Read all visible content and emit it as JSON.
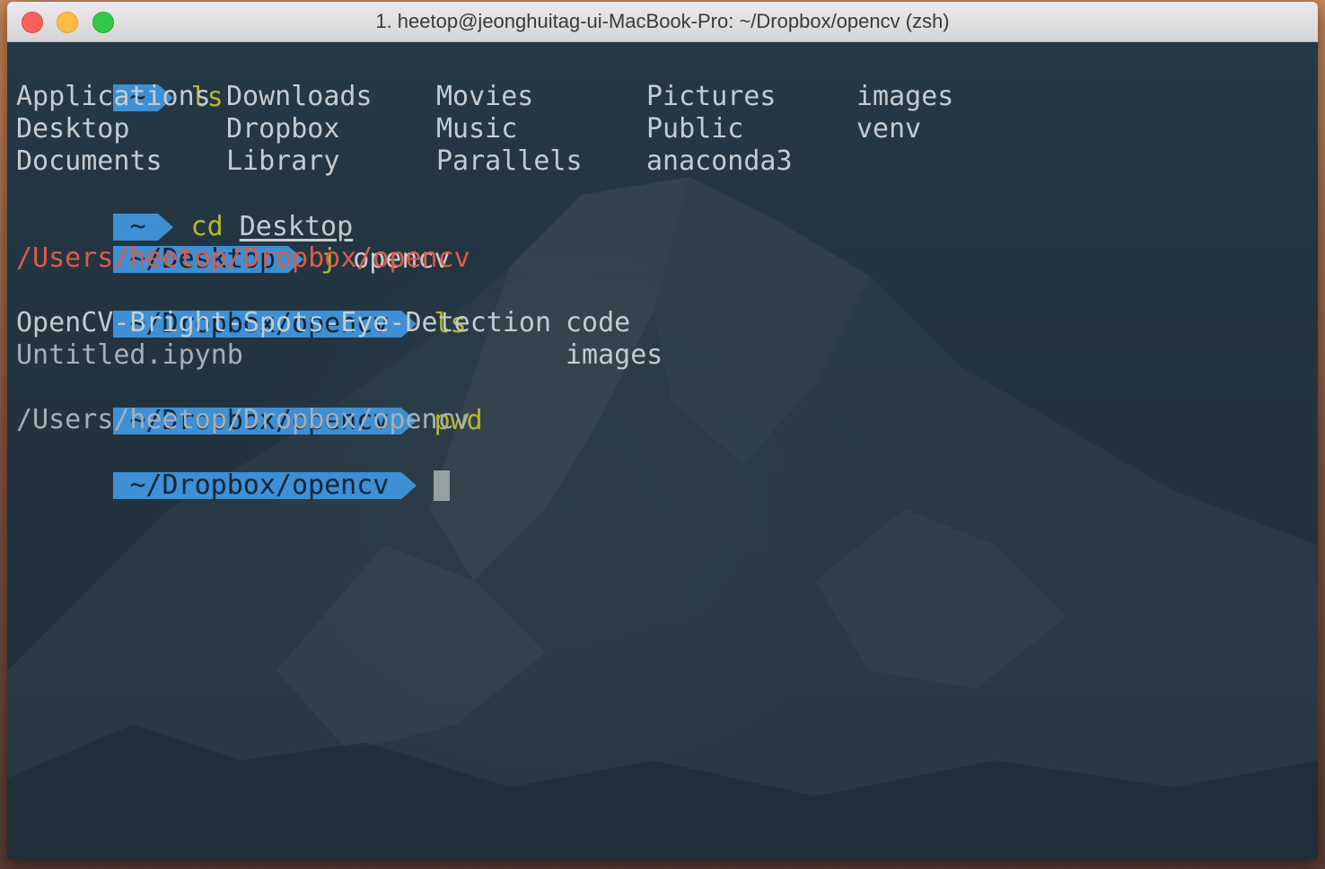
{
  "window": {
    "title": "1. heetop@jeonghuitag-ui-MacBook-Pro: ~/Dropbox/opencv (zsh)"
  },
  "colors": {
    "prompt_bg": "#3e8fd4",
    "command": "#b5b830",
    "error_text": "#e05a44",
    "terminal_bg": "#22323e"
  },
  "terminal": {
    "l1": {
      "prompt": "~",
      "cmd": "ls",
      "arg": ""
    },
    "ls1": [
      [
        "Applications",
        "Downloads",
        "Movies",
        "Pictures",
        "images"
      ],
      [
        "Desktop",
        "Dropbox",
        "Music",
        "Public",
        "venv"
      ],
      [
        "Documents",
        "Library",
        "Parallels",
        "anaconda3",
        ""
      ]
    ],
    "l5": {
      "prompt": "~",
      "cmd": "cd",
      "arg": "Desktop"
    },
    "l6": {
      "prompt": "~/Desktop",
      "cmd": "j",
      "arg": "opencv"
    },
    "l7": {
      "output": "/Users/heetop/Dropbox/opencv"
    },
    "l8": {
      "prompt": "~/Dropbox/opencv",
      "cmd": "ls"
    },
    "ls2": [
      [
        "OpenCV-Bright-Spots-Eye-Detection",
        "code"
      ],
      [
        "Untitled.ipynb",
        "images"
      ]
    ],
    "l11": {
      "prompt": "~/Dropbox/opencv",
      "cmd": "pwd"
    },
    "l12": {
      "output": "/Users/heetop/Dropbox/opencv"
    },
    "l13": {
      "prompt": "~/Dropbox/opencv"
    }
  }
}
